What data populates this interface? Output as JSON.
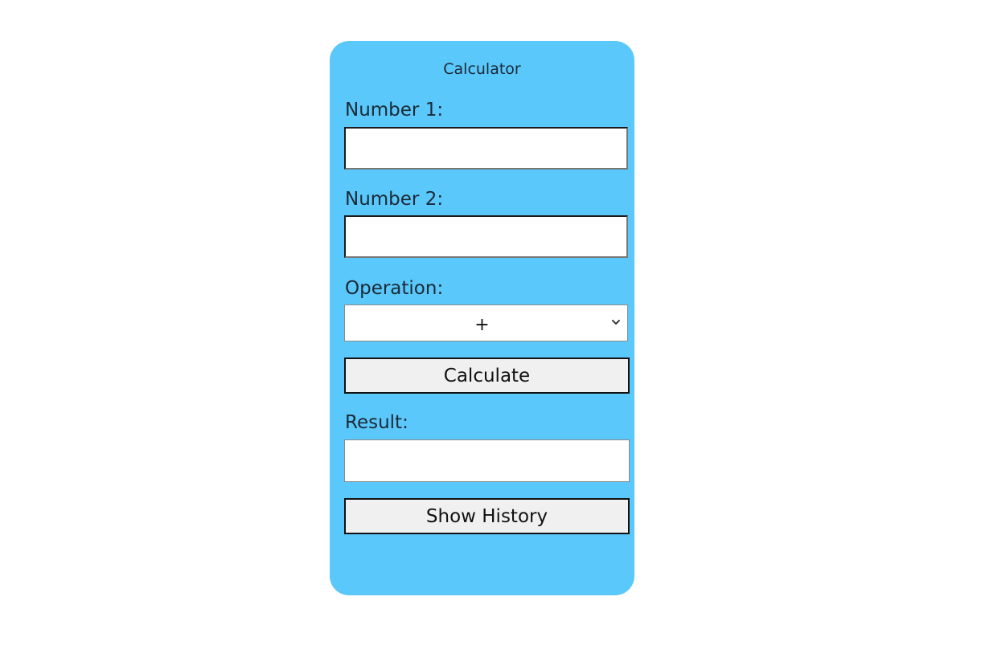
{
  "calculator": {
    "title": "Calculator",
    "number1": {
      "label": "Number 1:",
      "value": ""
    },
    "number2": {
      "label": "Number 2:",
      "value": ""
    },
    "operation": {
      "label": "Operation:",
      "selected": "+",
      "icon": "chevron-down-icon"
    },
    "calculate_label": "Calculate",
    "result": {
      "label": "Result:",
      "value": ""
    },
    "history_label": "Show History",
    "colors": {
      "card_background": "#5bc8fc",
      "button_background": "#f0f0f0",
      "text": "#1b2a36"
    }
  }
}
